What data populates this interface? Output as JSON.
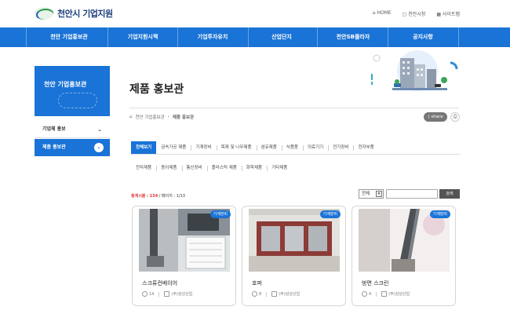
{
  "brand": {
    "name": "천안시 기업지원"
  },
  "utility": {
    "home": "HOME",
    "city": "천안시청",
    "sitemap": "사이트맵"
  },
  "gnb": [
    "천안 기업홍보관",
    "기업지원시책",
    "기업투자유치",
    "산업단지",
    "천안SB플라자",
    "공지사항"
  ],
  "sidebar": {
    "banner": "천안 기업홍보관",
    "items": [
      {
        "label": "기업체 홍보",
        "chev": "⌄"
      },
      {
        "label": "제품 홍보관",
        "chev": "⌄"
      }
    ]
  },
  "page": {
    "title": "제품 홍보관",
    "breadcrumb": [
      "천안 기업홍보관",
      "제품 홍보관"
    ],
    "share": "share",
    "print": "⎙"
  },
  "categories": {
    "row1": [
      "전체보기",
      "금속가공 제품",
      "기계장비",
      "목재 및 나무제품",
      "섬유제품",
      "식품품",
      "의료기기",
      "전기장비",
      "전자부품"
    ],
    "row2": [
      "전자제품",
      "종이제품",
      "통신장비",
      "플라스틱 제품",
      "화학제품",
      "기타제품"
    ],
    "active": "전체보기"
  },
  "list": {
    "count_label": "총게시물",
    "count_value": "154",
    "page_info": "/ 페이지 : 1/13",
    "select_value": "전체",
    "search_placeholder": "",
    "search_button": "검색"
  },
  "cards": [
    {
      "badge": "기계장비",
      "name": "스크류컨베이어",
      "views": "14",
      "company": "(주)삼성산업"
    },
    {
      "badge": "기계장비",
      "name": "호퍼",
      "views": "8",
      "company": "(주)삼성산업"
    },
    {
      "badge": "기계장비",
      "name": "벙면 스크린",
      "views": "4",
      "company": "(주)삼성산업"
    }
  ],
  "colors": {
    "primary": "#1a73d6",
    "accent_red": "#d33333"
  }
}
